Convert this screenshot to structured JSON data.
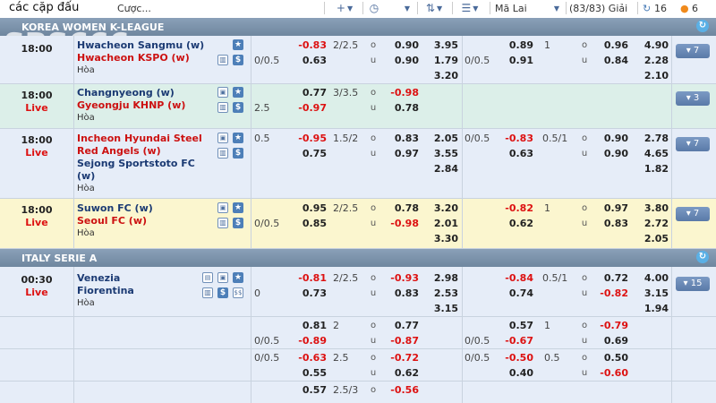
{
  "toolbar": {
    "title": "các cặp đấu",
    "bet_label": "Cược...",
    "plus_icon": "+",
    "clock_icon": "◷",
    "sort_icon": "⇅",
    "list_icon": "☰",
    "odds_type": "Mã Lai",
    "count": "(83/83)",
    "count_label": "Giải",
    "refresh_count": "16",
    "live_count": "6"
  },
  "watermark": "SBS666",
  "leagues": [
    {
      "name": "KOREA WOMEN K-LEAGUE"
    },
    {
      "name": "ITALY SERIE A"
    }
  ],
  "matches": [
    {
      "time": "18:00",
      "home": "Hwacheon Sangmu (w)",
      "away": "Hwacheon KSPO (w)",
      "draw": "Hòa",
      "ft_hdp_line": "0/0.5",
      "ft_hdp_home": "-0.83",
      "ft_hdp_away": "0.63",
      "ft_ou_line": "2/2.5",
      "ft_over_label": "o",
      "ft_under_label": "u",
      "ft_over": "0.90",
      "ft_under": "0.90",
      "ft_1x2": [
        "3.95",
        "1.79",
        "3.20"
      ],
      "h1_hdp_line": "0/0.5",
      "h1_hdp_home": "0.89",
      "h1_hdp_away": "0.91",
      "h1_ou_line": "1",
      "h1_over": "0.96",
      "h1_under": "0.84",
      "h1_1x2": [
        "4.90",
        "2.28",
        "2.10"
      ],
      "more": "▾ 7"
    },
    {
      "time": "18:00",
      "live": "Live",
      "home": "Changnyeong (w)",
      "away": "Gyeongju KHNP (w)",
      "draw": "Hòa",
      "ft_hdp_line": "2.5",
      "ft_hdp_home": "0.77",
      "ft_hdp_away": "-0.97",
      "ft_ou_line": "3/3.5",
      "ft_over": "-0.98",
      "ft_under": "0.78",
      "more": "▾ 3"
    },
    {
      "time": "18:00",
      "live": "Live",
      "home": "Incheon Hyundai Steel Red Angels (w)",
      "home_l1": "Incheon Hyundai Steel",
      "home_l2": "Red Angels (w)",
      "away_l1": "Sejong Sportstoto FC",
      "away_l2": "(w)",
      "draw": "Hòa",
      "ft_hdp_line": "0.5",
      "ft_hdp_home": "-0.95",
      "ft_hdp_away": "0.75",
      "ft_ou_line": "1.5/2",
      "ft_over": "0.83",
      "ft_under": "0.97",
      "ft_1x2": [
        "2.05",
        "3.55",
        "2.84"
      ],
      "h1_hdp_line": "0/0.5",
      "h1_hdp_home": "-0.83",
      "h1_hdp_away": "0.63",
      "h1_ou_line": "0.5/1",
      "h1_over": "0.90",
      "h1_under": "0.90",
      "h1_1x2": [
        "2.78",
        "4.65",
        "1.82"
      ],
      "more": "▾ 7"
    },
    {
      "time": "18:00",
      "live": "Live",
      "home": "Suwon FC (w)",
      "away": "Seoul FC (w)",
      "draw": "Hòa",
      "ft_hdp_line": "0/0.5",
      "ft_hdp_home": "0.95",
      "ft_hdp_away": "0.85",
      "ft_ou_line": "2/2.5",
      "ft_over": "0.78",
      "ft_under": "-0.98",
      "ft_1x2": [
        "3.20",
        "2.01",
        "3.30"
      ],
      "h1_hdp_line": "",
      "h1_hdp_home": "-0.82",
      "h1_hdp_away": "0.62",
      "h1_ou_line": "1",
      "h1_over": "0.97",
      "h1_under": "0.83",
      "h1_1x2": [
        "3.80",
        "2.72",
        "2.05"
      ],
      "more": "▾ 7"
    },
    {
      "time": "00:30",
      "live": "Live",
      "home": "Venezia",
      "away": "Fiorentina",
      "draw": "Hòa",
      "ft_hdp_line": "0",
      "ft_hdp_home": "-0.81",
      "ft_hdp_away": "0.73",
      "ft_ou_line": "2/2.5",
      "ft_over": "-0.93",
      "ft_under": "0.83",
      "ft_1x2": [
        "2.98",
        "2.53",
        "3.15"
      ],
      "h1_hdp_line": "",
      "h1_hdp_home": "-0.84",
      "h1_hdp_away": "0.74",
      "h1_ou_line": "0.5/1",
      "h1_over": "0.72",
      "h1_under": "-0.82",
      "h1_1x2": [
        "4.00",
        "3.15",
        "1.94"
      ],
      "more": "▾ 15"
    }
  ],
  "sublines": [
    {
      "ft_hdp_line": "0/0.5",
      "ft_hdp_home": "0.81",
      "ft_hdp_away": "-0.89",
      "ft_ou_line": "2",
      "ft_over": "0.77",
      "ft_under": "-0.87",
      "h1_hdp_line": "0/0.5",
      "h1_hdp_home": "0.57",
      "h1_hdp_away": "-0.67",
      "h1_ou_line": "1",
      "h1_over": "-0.79",
      "h1_under": "0.69"
    },
    {
      "ft_hdp_line": "0/0.5",
      "ft_hdp_home": "-0.63",
      "ft_hdp_away": "0.55",
      "ft_ou_line": "2.5",
      "ft_over": "-0.72",
      "ft_under": "0.62",
      "h1_hdp_line": "0/0.5",
      "h1_hdp_home": "-0.50",
      "h1_hdp_away": "0.40",
      "h1_ou_line": "0.5",
      "h1_over": "0.50",
      "h1_under": "-0.60"
    },
    {
      "ft_hdp_home": "0.57",
      "ft_ou_line": "2.5/3",
      "ft_over": "-0.56"
    }
  ]
}
